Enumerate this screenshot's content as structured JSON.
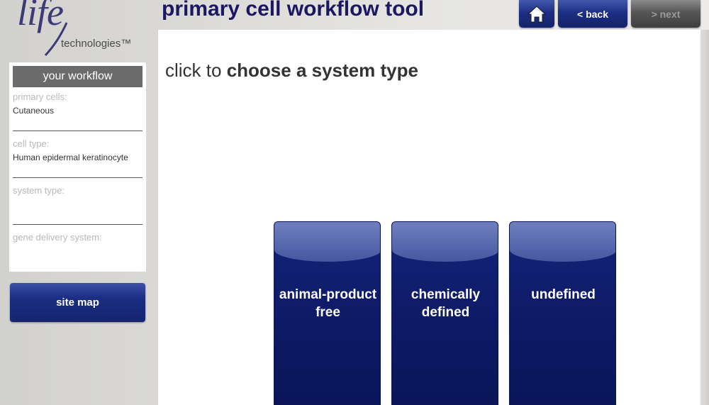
{
  "logo": {
    "word": "life",
    "sub": "technologies™"
  },
  "header": {
    "title": "primary cell workflow tool"
  },
  "nav": {
    "back_label": "< back",
    "next_label": "> next"
  },
  "workflow": {
    "title": "your workflow",
    "sections": [
      {
        "label": "primary cells:",
        "value": "Cutaneous"
      },
      {
        "label": "cell type:",
        "value": "Human epidermal keratinocyte"
      },
      {
        "label": "system type:",
        "value": ""
      },
      {
        "label": "gene delivery system:",
        "value": ""
      }
    ]
  },
  "sitemap": {
    "label": "site map"
  },
  "main": {
    "prompt_prefix": "click to",
    "prompt_emphasis": "choose a system type",
    "choices": [
      {
        "label": "animal-product free"
      },
      {
        "label": "chemically defined"
      },
      {
        "label": "undefined"
      }
    ]
  },
  "icons": {
    "home": "home-icon"
  },
  "colors": {
    "brand_navy": "#1c1763",
    "button_blue": "#1d2f85",
    "disabled_grey": "#555555"
  }
}
